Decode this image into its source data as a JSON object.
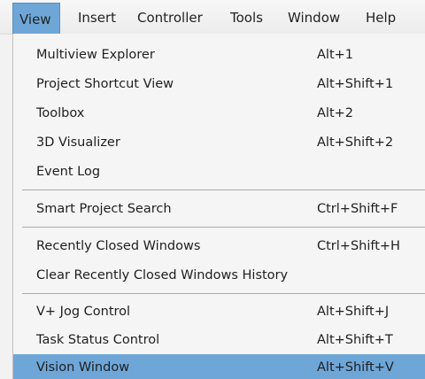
{
  "menubar": {
    "items": [
      {
        "label": "View"
      },
      {
        "label": "Insert"
      },
      {
        "label": "Controller"
      },
      {
        "label": "Tools"
      },
      {
        "label": "Window"
      },
      {
        "label": "Help"
      }
    ],
    "active_index": 0
  },
  "view_menu": {
    "items": [
      {
        "label": "Multiview Explorer",
        "shortcut": "Alt+1"
      },
      {
        "label": "Project Shortcut View",
        "shortcut": "Alt+Shift+1"
      },
      {
        "label": "Toolbox",
        "shortcut": "Alt+2"
      },
      {
        "label": "3D Visualizer",
        "shortcut": "Alt+Shift+2"
      },
      {
        "label": "Event Log",
        "shortcut": ""
      },
      {
        "label": "Smart Project Search",
        "shortcut": "Ctrl+Shift+F"
      },
      {
        "label": "Recently Closed Windows",
        "shortcut": "Ctrl+Shift+H"
      },
      {
        "label": "Clear Recently Closed Windows History",
        "shortcut": ""
      },
      {
        "label": "V+ Jog Control",
        "shortcut": "Alt+Shift+J"
      },
      {
        "label": "Task Status Control",
        "shortcut": "Alt+Shift+T"
      },
      {
        "label": "Vision Window",
        "shortcut": "Alt+Shift+V"
      }
    ],
    "highlighted_label": "Vision Window"
  },
  "colors": {
    "highlight": "#6ea6d8",
    "menu_background": "#f5f5f5",
    "separator": "#a9a9a9"
  }
}
